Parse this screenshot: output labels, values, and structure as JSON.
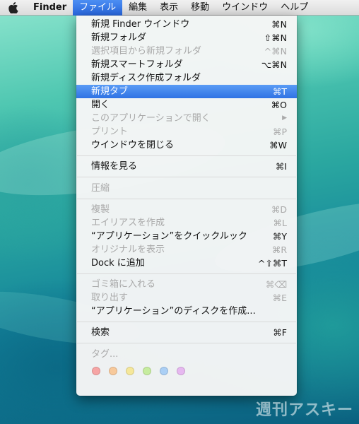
{
  "menubar": {
    "app_name": "Finder",
    "items": [
      "ファイル",
      "編集",
      "表示",
      "移動",
      "ウインドウ",
      "ヘルプ"
    ]
  },
  "menu": {
    "items": [
      {
        "label": "新規 Finder ウインドウ",
        "shortcut": "⌘N",
        "enabled": true
      },
      {
        "label": "新規フォルダ",
        "shortcut": "⇧⌘N",
        "enabled": true
      },
      {
        "label": "選択項目から新規フォルダ",
        "shortcut": "^⌘N",
        "enabled": false
      },
      {
        "label": "新規スマートフォルダ",
        "shortcut": "⌥⌘N",
        "enabled": true
      },
      {
        "label": "新規ディスク作成フォルダ",
        "shortcut": "",
        "enabled": true
      },
      {
        "label": "新規タブ",
        "shortcut": "⌘T",
        "enabled": true,
        "highlighted": true
      },
      {
        "label": "開く",
        "shortcut": "⌘O",
        "enabled": true
      },
      {
        "label": "このアプリケーションで開く",
        "shortcut": "▶",
        "enabled": false
      },
      {
        "label": "プリント",
        "shortcut": "⌘P",
        "enabled": false
      },
      {
        "label": "ウインドウを閉じる",
        "shortcut": "⌘W",
        "enabled": true
      },
      {
        "label": "情報を見る",
        "shortcut": "⌘I",
        "enabled": true
      },
      {
        "label": "圧縮",
        "shortcut": "",
        "enabled": false
      },
      {
        "label": "複製",
        "shortcut": "⌘D",
        "enabled": false
      },
      {
        "label": "エイリアスを作成",
        "shortcut": "⌘L",
        "enabled": false
      },
      {
        "label": "“アプリケーション”をクイックルック",
        "shortcut": "⌘Y",
        "enabled": true
      },
      {
        "label": "オリジナルを表示",
        "shortcut": "⌘R",
        "enabled": false
      },
      {
        "label": "Dock に追加",
        "shortcut": "^⇧⌘T",
        "enabled": true
      },
      {
        "label": "ゴミ箱に入れる",
        "shortcut": "⌘⌫",
        "enabled": false
      },
      {
        "label": "取り出す",
        "shortcut": "⌘E",
        "enabled": false
      },
      {
        "label": "“アプリケーション”のディスクを作成...",
        "shortcut": "",
        "enabled": true
      },
      {
        "label": "検索",
        "shortcut": "⌘F",
        "enabled": true
      },
      {
        "label": "タグ...",
        "shortcut": "",
        "enabled": false
      }
    ],
    "tag_colors": [
      "#f6a5a5",
      "#f7c99b",
      "#f5e79a",
      "#c6ec9f",
      "#aacff5",
      "#e6b8f0"
    ]
  },
  "watermark": "週刊アスキー"
}
